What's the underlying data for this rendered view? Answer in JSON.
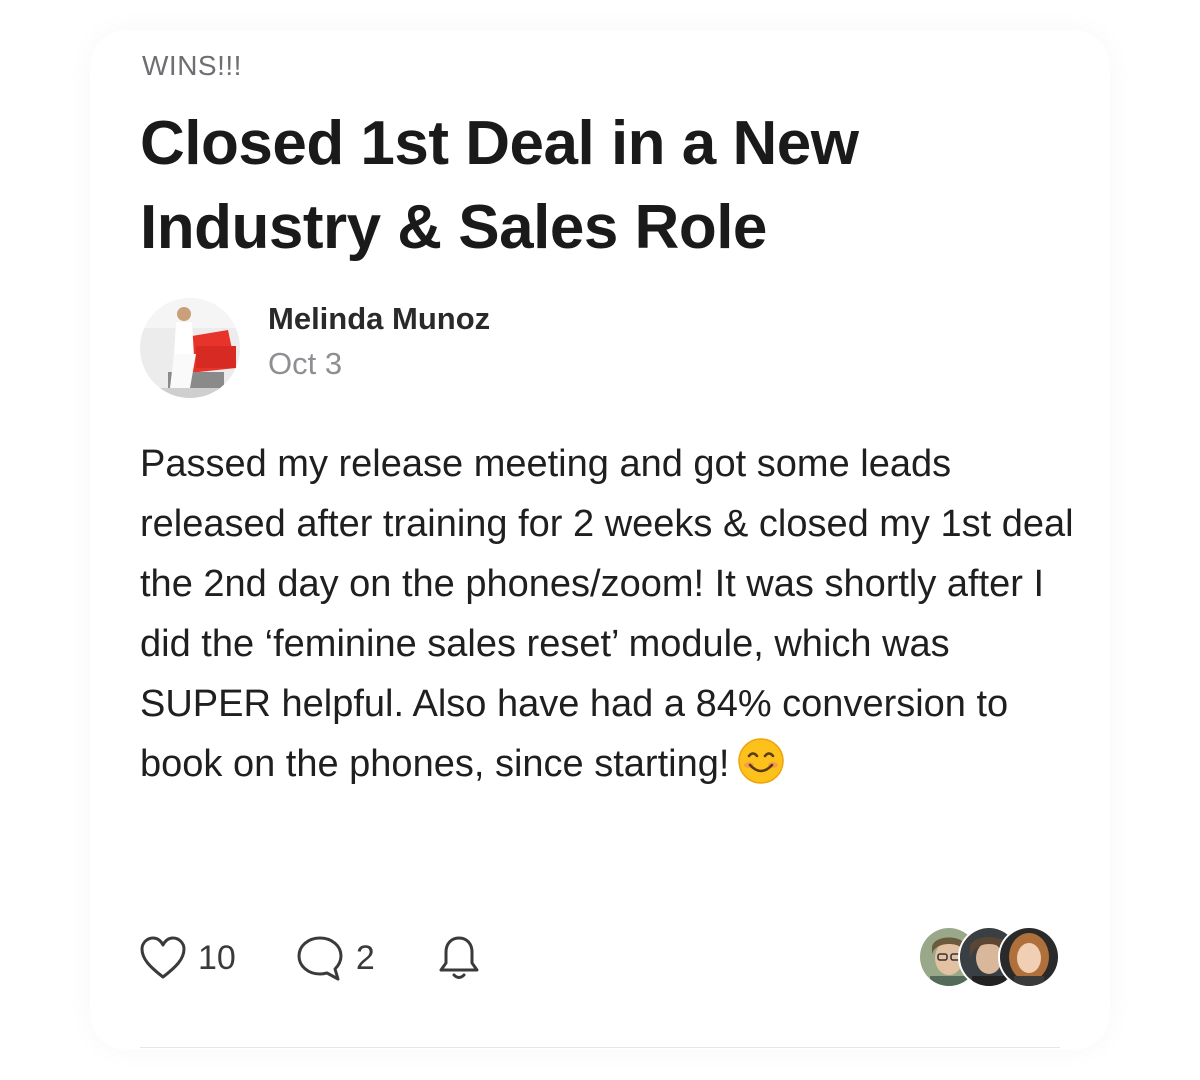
{
  "post": {
    "category": "WINS!!!",
    "title": "Closed 1st Deal in a New Industry & Sales Role",
    "author": {
      "name": "Melinda Munoz",
      "date": "Oct 3"
    },
    "body": "Passed my release meeting and got some leads released after training for 2 weeks & closed my 1st deal the 2nd day on the phones/zoom! It was shortly after I did the ‘feminine sales reset’ module, which was SUPER helpful. Also have had a 84% conversion to book on the phones, since starting!",
    "body_emoji": "smiling-face-emoji"
  },
  "actions": {
    "likes": "10",
    "comments": "2",
    "like_icon": "heart-icon",
    "comment_icon": "speech-bubble-icon",
    "notify_icon": "bell-icon"
  },
  "participants": {
    "count": 3
  },
  "colors": {
    "text_primary": "#1a1a1a",
    "text_secondary": "#8e8e93",
    "accent_avatar": "#e8332a"
  }
}
